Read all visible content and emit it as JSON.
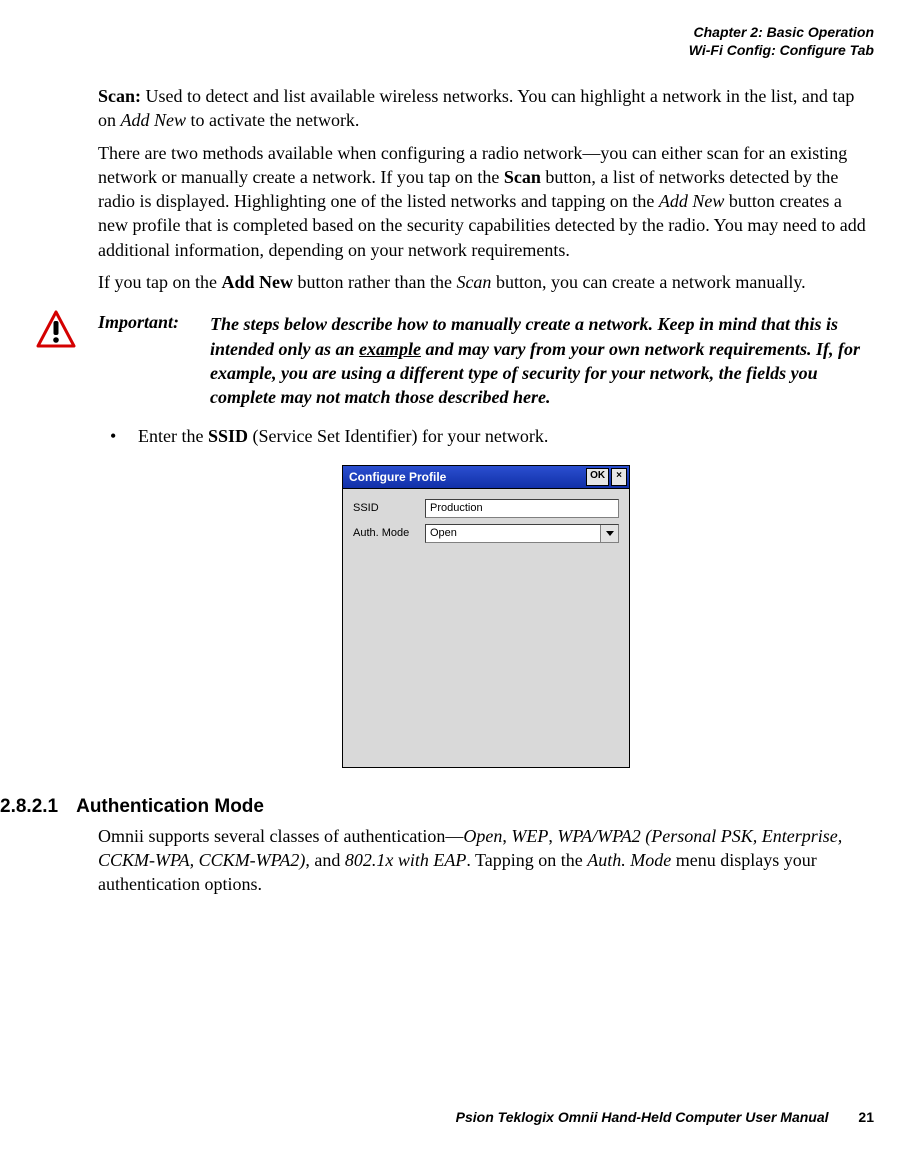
{
  "header": {
    "chapter": "Chapter 2: Basic Operation",
    "section": "Wi-Fi Config: Configure Tab"
  },
  "body": {
    "p1_label": "Scan:",
    "p1_rest": " Used to detect and list available wireless networks. You can highlight a network in the list, and tap on ",
    "p1_addnew": "Add New",
    "p1_end": " to activate the network.",
    "p2_a": "There are two methods available when configuring a radio network—you can either scan for an existing network or manually create a network. If you tap on the ",
    "p2_scan": "Scan",
    "p2_b": " button, a list of networks detected by the radio is displayed. Highlighting one of the listed networks and tapping on the ",
    "p2_addnew": "Add New",
    "p2_c": " button creates a new profile that is completed based on the security capabilities detected by the radio. You may need to add additional information, depending on your network requirements.",
    "p3_a": "If you tap on the ",
    "p3_addnew": "Add New",
    "p3_b": " button rather than the ",
    "p3_scan": "Scan",
    "p3_c": " button, you can create a network manually.",
    "imp_label": "Important:",
    "imp_text_a": "The steps below describe how to manually create a network. Keep in mind that this is intended only as an ",
    "imp_text_ex": "example",
    "imp_text_b": " and may vary from your own network requirements. If, for example, you are using a different type of security for your network, the fields you complete may not match those described here.",
    "bullet_a": "Enter the ",
    "bullet_ssid": "SSID",
    "bullet_b": " (Service Set Identifier) for your network."
  },
  "dialog": {
    "title": "Configure Profile",
    "ok": "OK",
    "ssid_label": "SSID",
    "ssid_value": "Production",
    "auth_label": "Auth. Mode",
    "auth_value": "Open"
  },
  "section": {
    "number": "2.8.2.1",
    "title": "Authentication Mode"
  },
  "para4": {
    "a": "Omnii supports several classes of authentication—",
    "open": "Open",
    "c1": ", ",
    "wep": "WEP",
    "c2": ", ",
    "wpa": "WPA/WPA2 (Personal PSK, Enterprise, CCKM-WPA, CCKM-WPA2)",
    "c3": ", and ",
    "eap": "802.1x with EAP",
    "b": ". Tapping on the ",
    "authmode": "Auth. Mode",
    "c": " menu displays your authentication options."
  },
  "footer": {
    "text": "Psion Teklogix Omnii Hand-Held Computer User Manual",
    "page": "21"
  }
}
